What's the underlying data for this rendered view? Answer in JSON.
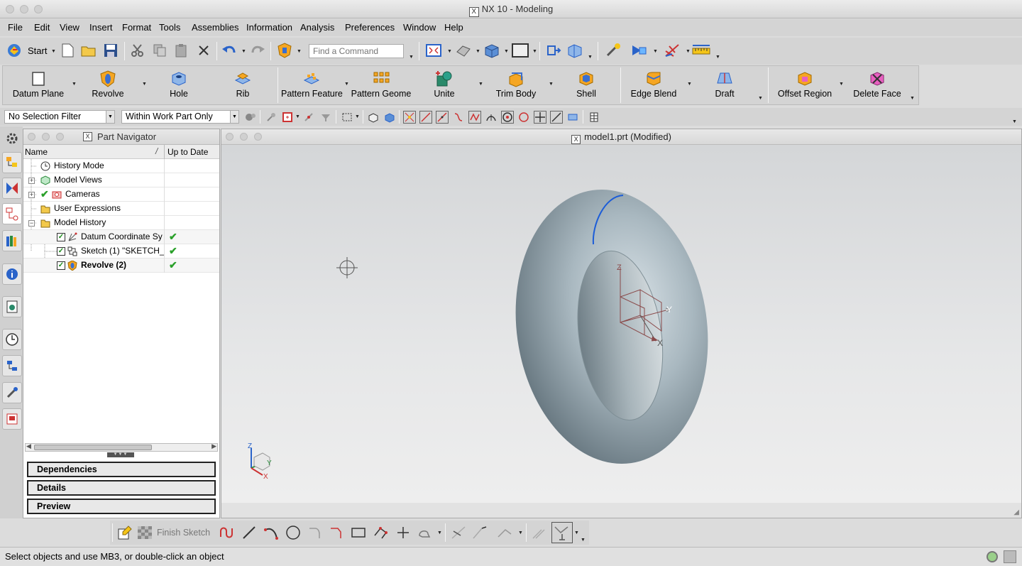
{
  "window": {
    "title": "NX 10 - Modeling"
  },
  "menu": [
    "File",
    "Edit",
    "View",
    "Insert",
    "Format",
    "Tools",
    "Assemblies",
    "Information",
    "Analysis",
    "Preferences",
    "Window",
    "Help"
  ],
  "toolbar": {
    "start_label": "Start",
    "find_placeholder": "Find a Command"
  },
  "ribbon": {
    "datum_plane": "Datum Plane",
    "revolve": "Revolve",
    "hole": "Hole",
    "rib": "Rib",
    "pattern_feature": "Pattern Feature",
    "pattern_geometry": "Pattern Geome",
    "unite": "Unite",
    "trim_body": "Trim Body",
    "shell": "Shell",
    "edge_blend": "Edge Blend",
    "draft": "Draft",
    "offset_region": "Offset Region",
    "delete_face": "Delete Face"
  },
  "filters": {
    "selection_filter": "No Selection Filter",
    "scope": "Within Work Part Only"
  },
  "navigator": {
    "title": "Part Navigator",
    "col_name": "Name",
    "col_uptodate": "Up to Date",
    "rows": [
      {
        "label": "History Mode"
      },
      {
        "label": "Model Views"
      },
      {
        "label": "Cameras"
      },
      {
        "label": "User Expressions"
      },
      {
        "label": "Model History"
      },
      {
        "label": "Datum Coordinate Sy"
      },
      {
        "label": "Sketch (1) \"SKETCH_"
      },
      {
        "label": "Revolve (2)"
      }
    ],
    "sections": {
      "dependencies": "Dependencies",
      "details": "Details",
      "preview": "Preview"
    }
  },
  "viewport": {
    "title": "model1.prt (Modified)",
    "axis_z": "Z",
    "axis_y": "Y",
    "axis_x": "X"
  },
  "sketch_toolbar": {
    "finish_sketch": "Finish Sketch"
  },
  "status": {
    "message": "Select objects and use MB3, or double-click an object"
  },
  "colors": {
    "accent_blue": "#1c5dd8",
    "check_green": "#2aa02a",
    "torus": "#9aaab2"
  }
}
